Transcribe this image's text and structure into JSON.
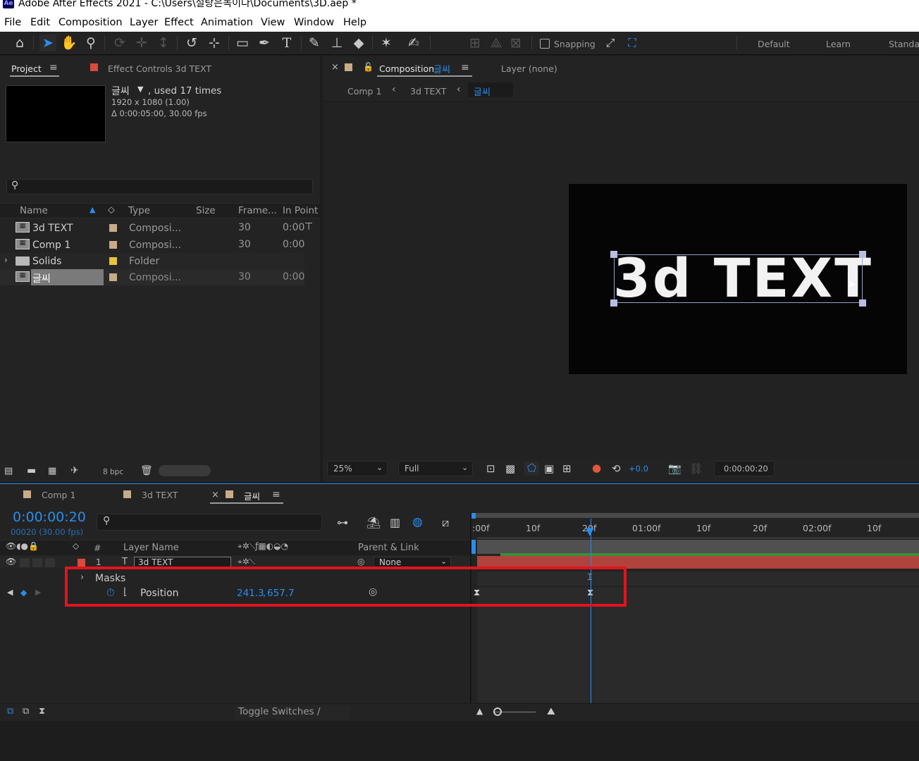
{
  "window": {
    "title": "Adobe After Effects 2021 - C:\\Users\\설탕은녹이다\\Documents\\3D.aep *",
    "logo": "Ae"
  },
  "menu": [
    "File",
    "Edit",
    "Composition",
    "Layer",
    "Effect",
    "Animation",
    "View",
    "Window",
    "Help"
  ],
  "toolbar": {
    "snapping_label": "Snapping",
    "workspaces": [
      "Default",
      "Learn",
      "Standar"
    ]
  },
  "project_panel": {
    "tab_project": "Project",
    "tab_effect_controls": "Effect Controls 3d TEXT",
    "item_name": "글씨",
    "item_usage": ", used 17 times",
    "item_dims": "1920 x 1080 (1.00)",
    "item_duration": "Δ 0:00:05:00, 30.00 fps",
    "search_placeholder": "",
    "columns": [
      "Name",
      "Type",
      "Size",
      "Frame...",
      "In Point"
    ],
    "rows": [
      {
        "name": "3d TEXT",
        "type": "Composi...",
        "frame": "30",
        "in_point": "0:00"
      },
      {
        "name": "Comp 1",
        "type": "Composi...",
        "frame": "30",
        "in_point": "0:00"
      },
      {
        "name": "Solids",
        "type": "Folder",
        "frame": "",
        "in_point": ""
      },
      {
        "name": "글씨",
        "type": "Composi...",
        "frame": "30",
        "in_point": "0:00"
      }
    ],
    "bpc": "8 bpc",
    "colors": {
      "comp_label": "#c8ab89",
      "folder_label": "#e5c43c"
    }
  },
  "comp_panel": {
    "tab_composition": "Composition",
    "tab_comp_name": "글씨",
    "tab_layer": "Layer (none)",
    "breadcrumbs": [
      "Comp 1",
      "3d TEXT",
      "글씨"
    ],
    "canvas_text": "3d TEXT",
    "zoom": "25%",
    "resolution": "Full",
    "exposure": "+0.0",
    "timecode": "0:00:00:20",
    "colors": {
      "accent": "#2d8ceb",
      "effect_controls_swatch": "#d94a3f"
    }
  },
  "timeline": {
    "tabs": [
      "Comp 1",
      "3d TEXT",
      "글씨"
    ],
    "timecode": "0:00:00:20",
    "fps_info": "00020 (30.00 fps)",
    "headers": {
      "number": "#",
      "layer_name": "Layer Name",
      "parent": "Parent & Link"
    },
    "layer": {
      "index": "1",
      "name": "3d TEXT",
      "parent": "None"
    },
    "masks_label": "Masks",
    "position_label": "Position",
    "position_value_x": "241.3",
    "position_value_y": "657.7",
    "ruler_labels": [
      ":00f",
      "10f",
      "20f",
      "01:00f",
      "10f",
      "20f",
      "02:00f",
      "10f"
    ],
    "toggle_label": "Toggle Switches / Modes",
    "colors": {
      "layer_bar": "#b0433c",
      "work_area": "#3a8f3a",
      "highlight_box": "#e1141e"
    }
  }
}
